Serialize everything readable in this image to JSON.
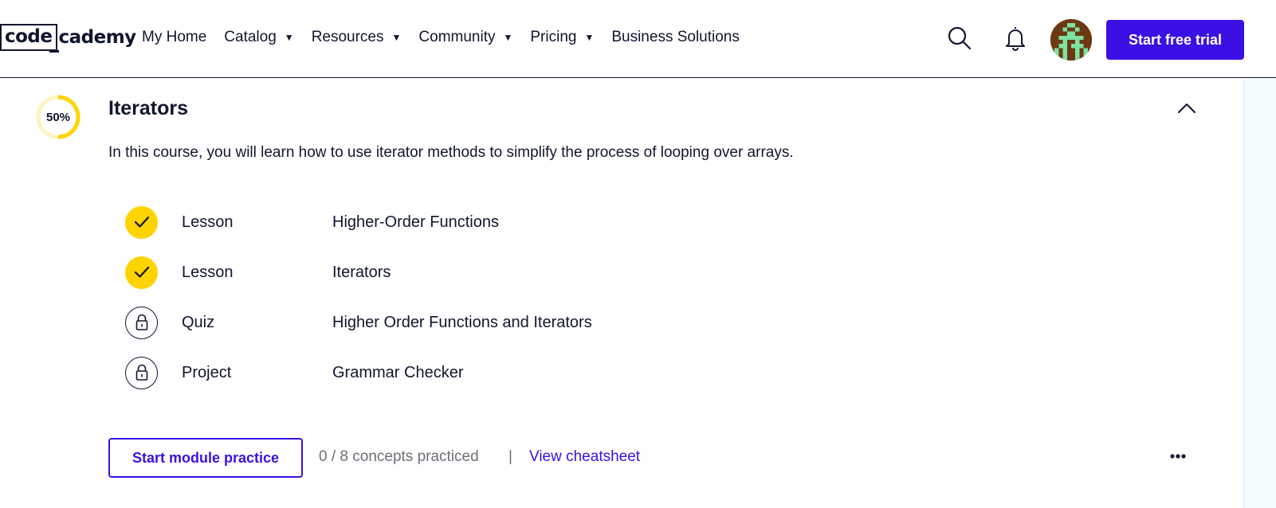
{
  "header": {
    "logo_part1": "code",
    "logo_part2": "cademy",
    "nav": [
      {
        "label": "My Home",
        "has_dropdown": false
      },
      {
        "label": "Catalog",
        "has_dropdown": true
      },
      {
        "label": "Resources",
        "has_dropdown": true
      },
      {
        "label": "Community",
        "has_dropdown": true
      },
      {
        "label": "Pricing",
        "has_dropdown": true
      },
      {
        "label": "Business Solutions",
        "has_dropdown": false
      }
    ],
    "caret": "▼",
    "search_icon": "search-icon",
    "notification_icon": "bell-icon",
    "trial_button": "Start free trial",
    "accent_color": "#3a10e5"
  },
  "module": {
    "progress": "50%",
    "progress_fraction": 0.5,
    "progress_color": "#ffd300",
    "title": "Iterators",
    "description": "In this course, you will learn how to use iterator methods to simplify the process of looping over arrays.",
    "items": [
      {
        "type": "Lesson",
        "name": "Higher-Order Functions",
        "status": "completed"
      },
      {
        "type": "Lesson",
        "name": "Iterators",
        "status": "completed"
      },
      {
        "type": "Quiz",
        "name": "Higher Order Functions and Iterators",
        "status": "locked"
      },
      {
        "type": "Project",
        "name": "Grammar Checker",
        "status": "locked"
      }
    ],
    "practice_button": "Start module practice",
    "concepts_text": "0 / 8 concepts practiced",
    "separator": "|",
    "cheatsheet_link": "View cheatsheet"
  }
}
